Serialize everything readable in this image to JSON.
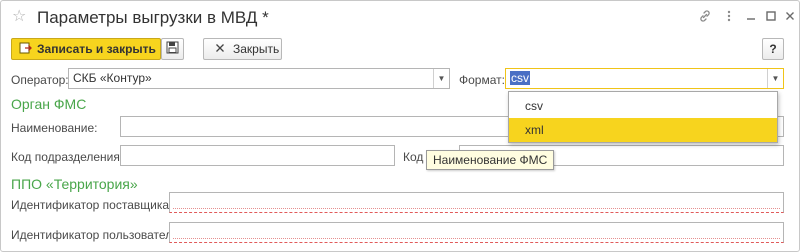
{
  "window": {
    "title": "Параметры выгрузки в МВД *",
    "favorite_icon": "☆",
    "controls": {
      "link_icon": "🔗",
      "menu_icon": "⋮",
      "minimize_icon": "–",
      "maximize_icon": "□",
      "close_icon": "✕"
    }
  },
  "toolbar": {
    "save_close_label": "Записать и закрыть",
    "close_label": "Закрыть",
    "help_label": "?"
  },
  "form": {
    "operator_label": "Оператор:",
    "operator_value": "СКБ «Контур»",
    "format_label": "Формат:",
    "format_value": "csv",
    "section_fms": "Орган ФМС",
    "name_label": "Наименование:",
    "name_value": "",
    "subdivision_code_label": "Код подразделения:",
    "subdivision_code_value": "",
    "code_label_partial": "Код",
    "section_ppo": "ППО «Территория»",
    "supplier_id_label": "Идентификатор поставщика:",
    "supplier_id_value": "",
    "user_id_label": "Идентификатор пользователя:",
    "user_id_value": ""
  },
  "format_dropdown": {
    "options": [
      "csv",
      "xml"
    ],
    "highlighted": "xml"
  },
  "tooltip": {
    "text": "Наименование ФМС"
  },
  "colors": {
    "accent": "#f7d41e",
    "section": "#49a64a",
    "selection": "#4a6fc4",
    "required": "#e05a5a"
  }
}
